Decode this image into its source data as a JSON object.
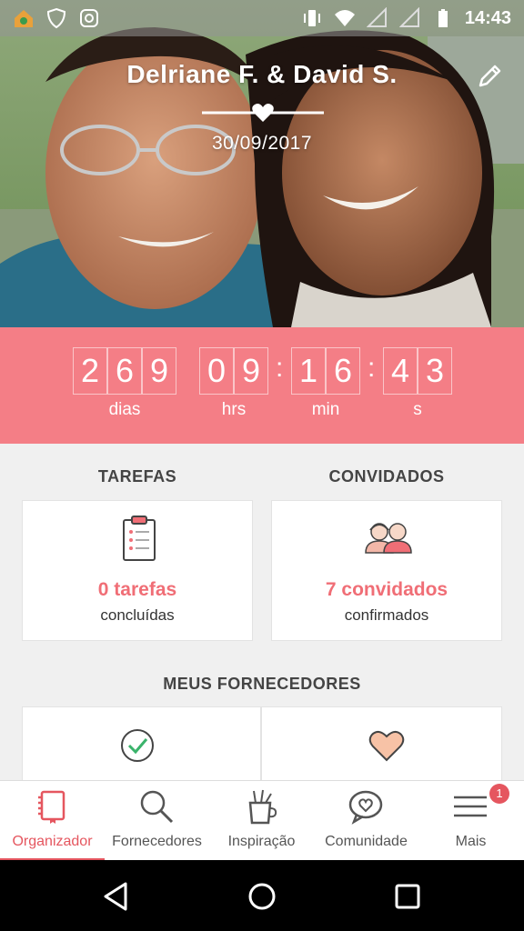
{
  "status_bar": {
    "time": "14:43",
    "left_icons": [
      "app-store-icon",
      "shield-icon",
      "instagram-icon"
    ],
    "right_icons": [
      "vibrate-icon",
      "wifi-icon",
      "signal-icon",
      "signal-icon",
      "battery-icon"
    ]
  },
  "header": {
    "couple_name": "Delriane F. & David S.",
    "date": "30/09/2017"
  },
  "countdown": {
    "days_digits": [
      "2",
      "6",
      "9"
    ],
    "hours_digits": [
      "0",
      "9"
    ],
    "minutes_digits": [
      "1",
      "6"
    ],
    "seconds_digits": [
      "4",
      "3"
    ],
    "days_label": "dias",
    "hours_label": "hrs",
    "minutes_label": "min",
    "seconds_label": "s",
    "separator": ":"
  },
  "tasks": {
    "title": "TAREFAS",
    "count": "0 tarefas",
    "caption": "concluídas"
  },
  "guests": {
    "title": "CONVIDADOS",
    "count": "7 convidados",
    "caption": "confirmados"
  },
  "vendors": {
    "title": "MEUS FORNECEDORES"
  },
  "bottom_nav": {
    "items": [
      {
        "label": "Organizador",
        "icon": "notebook-icon",
        "active": true
      },
      {
        "label": "Fornecedores",
        "icon": "search-icon",
        "active": false
      },
      {
        "label": "Inspiração",
        "icon": "brush-cup-icon",
        "active": false
      },
      {
        "label": "Comunidade",
        "icon": "chat-heart-icon",
        "active": false
      },
      {
        "label": "Mais",
        "icon": "menu-icon",
        "active": false
      }
    ],
    "badge": "1"
  },
  "colors": {
    "accent": "#f47e86",
    "accent_dark": "#e5565f"
  }
}
